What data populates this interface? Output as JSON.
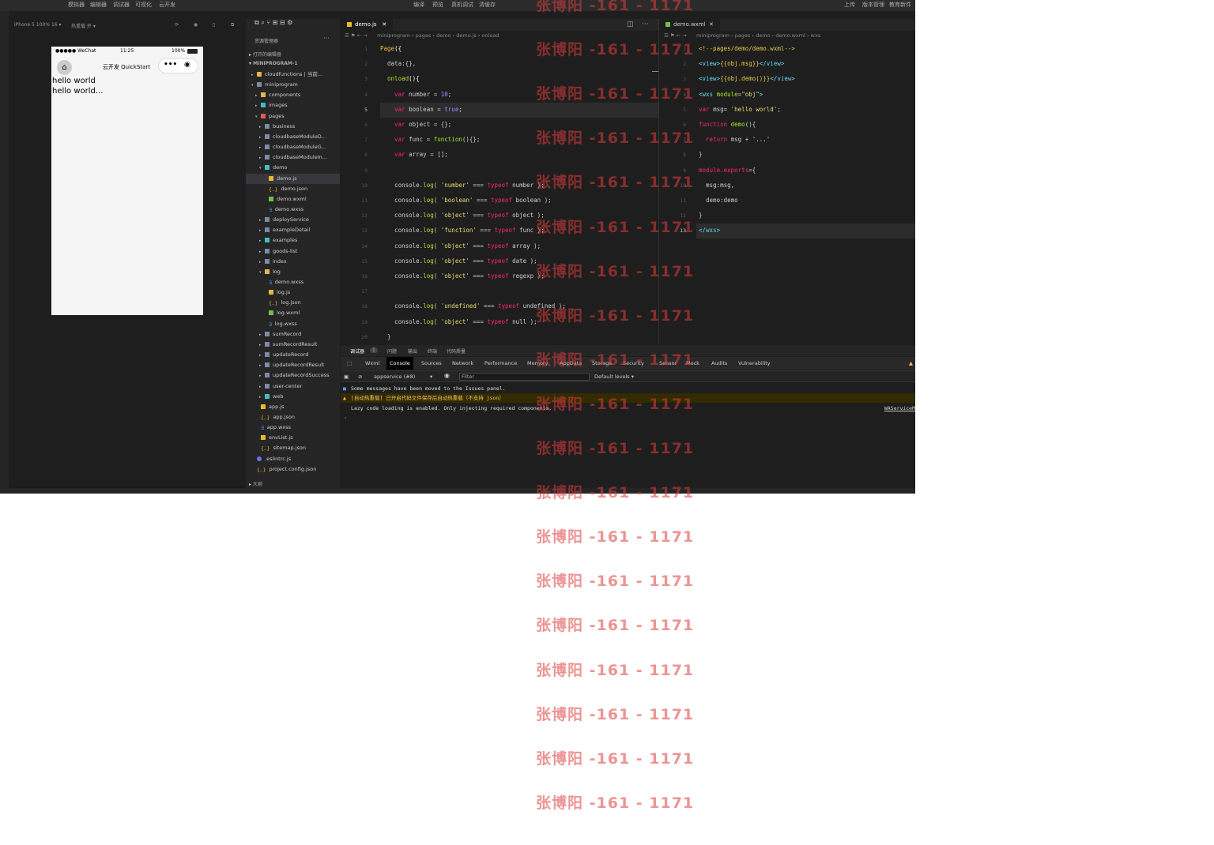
{
  "menubar": {
    "left": [
      "模拟器",
      "编辑器",
      "调试器",
      "可视化",
      "云开发"
    ],
    "center": [
      "编译",
      "预览",
      "真机调试",
      "清缓存"
    ],
    "right": [
      "上传",
      "版本管理",
      "教育新件"
    ]
  },
  "simulator": {
    "device": "iPhone 5 100% 16 ▾",
    "hotreload": "热重载 开 ▾",
    "status_carrier": "●●●●● WeChat",
    "status_time": "11:25",
    "status_battery": "100%",
    "nav_title": "云开发 QuickStart",
    "capsule_dots": "•••",
    "body_lines": [
      "hello world",
      "hello world..."
    ]
  },
  "explorer": {
    "title": "资源管理器",
    "open_editors": "打开的编辑器",
    "project": "MINIPROGRAM-1",
    "outline": "大纲",
    "items": [
      {
        "label": "cloudfunctions | 当前...",
        "type": "folderspec",
        "depth": 1,
        "arrow": "▸"
      },
      {
        "label": "miniprogram",
        "type": "folder",
        "depth": 1,
        "arrow": "▾"
      },
      {
        "label": "components",
        "type": "folderspec",
        "depth": 2,
        "arrow": "▸"
      },
      {
        "label": "images",
        "type": "folderteal",
        "depth": 2,
        "arrow": "▸"
      },
      {
        "label": "pages",
        "type": "folderred",
        "depth": 2,
        "arrow": "▾"
      },
      {
        "label": "business",
        "type": "folder",
        "depth": 3,
        "arrow": "▸"
      },
      {
        "label": "cloudbaseModuleD...",
        "type": "folder",
        "depth": 3,
        "arrow": "▸"
      },
      {
        "label": "cloudbaseModuleG...",
        "type": "folder",
        "depth": 3,
        "arrow": "▸"
      },
      {
        "label": "cloudbaseModuleIn...",
        "type": "folder",
        "depth": 3,
        "arrow": "▸"
      },
      {
        "label": "demo",
        "type": "folderteal",
        "depth": 3,
        "arrow": "▾"
      },
      {
        "label": "demo.js",
        "type": "js",
        "depth": 4,
        "arrow": "",
        "sel": true
      },
      {
        "label": "demo.json",
        "type": "json",
        "depth": 4,
        "arrow": ""
      },
      {
        "label": "demo.wxml",
        "type": "wxml",
        "depth": 4,
        "arrow": ""
      },
      {
        "label": "demo.wxss",
        "type": "wxss",
        "depth": 4,
        "arrow": ""
      },
      {
        "label": "deployService",
        "type": "folder",
        "depth": 3,
        "arrow": "▸"
      },
      {
        "label": "exampleDetail",
        "type": "folder",
        "depth": 3,
        "arrow": "▸"
      },
      {
        "label": "examples",
        "type": "folderteal",
        "depth": 3,
        "arrow": "▸"
      },
      {
        "label": "goods-list",
        "type": "folder",
        "depth": 3,
        "arrow": "▸"
      },
      {
        "label": "index",
        "type": "folder",
        "depth": 3,
        "arrow": "▸"
      },
      {
        "label": "log",
        "type": "folderspec",
        "depth": 3,
        "arrow": "▾"
      },
      {
        "label": "demo.wxss",
        "type": "wxss",
        "depth": 4,
        "arrow": ""
      },
      {
        "label": "log.js",
        "type": "js",
        "depth": 4,
        "arrow": ""
      },
      {
        "label": "log.json",
        "type": "json",
        "depth": 4,
        "arrow": ""
      },
      {
        "label": "log.wxml",
        "type": "wxml",
        "depth": 4,
        "arrow": ""
      },
      {
        "label": "log.wxss",
        "type": "wxss",
        "depth": 4,
        "arrow": ""
      },
      {
        "label": "sumRecord",
        "type": "folder",
        "depth": 3,
        "arrow": "▸"
      },
      {
        "label": "sumRecordResult",
        "type": "folder",
        "depth": 3,
        "arrow": "▸"
      },
      {
        "label": "updateRecord",
        "type": "folder",
        "depth": 3,
        "arrow": "▸"
      },
      {
        "label": "updateRecordResult",
        "type": "folder",
        "depth": 3,
        "arrow": "▸"
      },
      {
        "label": "updateRecordSuccess",
        "type": "folder",
        "depth": 3,
        "arrow": "▸"
      },
      {
        "label": "user-center",
        "type": "folder",
        "depth": 3,
        "arrow": "▸"
      },
      {
        "label": "web",
        "type": "folderteal",
        "depth": 3,
        "arrow": "▸"
      },
      {
        "label": "app.js",
        "type": "js",
        "depth": 2,
        "arrow": ""
      },
      {
        "label": "app.json",
        "type": "json",
        "depth": 2,
        "arrow": ""
      },
      {
        "label": "app.wxss",
        "type": "wxss",
        "depth": 2,
        "arrow": ""
      },
      {
        "label": "envList.js",
        "type": "js",
        "depth": 2,
        "arrow": ""
      },
      {
        "label": "sitemap.json",
        "type": "json",
        "depth": 2,
        "arrow": ""
      },
      {
        "label": ".eslintrc.js",
        "type": "eslint",
        "depth": 1,
        "arrow": ""
      },
      {
        "label": "project.config.json",
        "type": "json",
        "depth": 1,
        "arrow": ""
      }
    ]
  },
  "editor1": {
    "tab": "demo.js",
    "close": "✕",
    "breadcrumb": [
      "miniprogram",
      "pages",
      "demo",
      "demo.js",
      "onload"
    ],
    "lines": [
      [
        [
          "Page",
          "fn"
        ],
        [
          "({",
          "p"
        ]
      ],
      [
        [
          "  data",
          ""
        ],
        [
          ":{},",
          ""
        ]
      ],
      [
        [
          "  onload",
          "f"
        ],
        [
          "(){",
          "p"
        ]
      ],
      [
        [
          "    var ",
          "k"
        ],
        [
          "number = ",
          ""
        ],
        [
          "10",
          "n"
        ],
        [
          ";",
          ""
        ]
      ],
      [
        [
          "    var ",
          "k"
        ],
        [
          "boolean = ",
          ""
        ],
        [
          "true",
          "b"
        ],
        [
          ";",
          ""
        ]
      ],
      [
        [
          "    var ",
          "k"
        ],
        [
          "object = {};",
          ""
        ]
      ],
      [
        [
          "    var ",
          "k"
        ],
        [
          "func = ",
          ""
        ],
        [
          "function",
          "f"
        ],
        [
          "(){};",
          ""
        ]
      ],
      [
        [
          "    var ",
          "k"
        ],
        [
          "array = [];",
          ""
        ]
      ],
      [
        [
          "",
          ""
        ]
      ],
      [
        [
          "    console.",
          ""
        ],
        [
          "log",
          "f"
        ],
        [
          "( ",
          ""
        ],
        [
          "'number'",
          "s"
        ],
        [
          " === ",
          ""
        ],
        [
          "typeof",
          "k"
        ],
        [
          " number );",
          ""
        ]
      ],
      [
        [
          "    console.",
          ""
        ],
        [
          "log",
          "f"
        ],
        [
          "( ",
          ""
        ],
        [
          "'boolean'",
          "s"
        ],
        [
          " === ",
          ""
        ],
        [
          "typeof",
          "k"
        ],
        [
          " boolean );",
          ""
        ]
      ],
      [
        [
          "    console.",
          ""
        ],
        [
          "log",
          "f"
        ],
        [
          "( ",
          ""
        ],
        [
          "'object'",
          "s"
        ],
        [
          " === ",
          ""
        ],
        [
          "typeof",
          "k"
        ],
        [
          " object );",
          ""
        ]
      ],
      [
        [
          "    console.",
          ""
        ],
        [
          "log",
          "f"
        ],
        [
          "( ",
          ""
        ],
        [
          "'function'",
          "s"
        ],
        [
          " === ",
          ""
        ],
        [
          "typeof",
          "k"
        ],
        [
          " func );",
          ""
        ]
      ],
      [
        [
          "    console.",
          ""
        ],
        [
          "log",
          "f"
        ],
        [
          "( ",
          ""
        ],
        [
          "'object'",
          "s"
        ],
        [
          " === ",
          ""
        ],
        [
          "typeof",
          "k"
        ],
        [
          " array );",
          ""
        ]
      ],
      [
        [
          "    console.",
          ""
        ],
        [
          "log",
          "f"
        ],
        [
          "( ",
          ""
        ],
        [
          "'object'",
          "s"
        ],
        [
          " === ",
          ""
        ],
        [
          "typeof",
          "k"
        ],
        [
          " date );",
          ""
        ]
      ],
      [
        [
          "    console.",
          ""
        ],
        [
          "log",
          "f"
        ],
        [
          "( ",
          ""
        ],
        [
          "'object'",
          "s"
        ],
        [
          " === ",
          ""
        ],
        [
          "typeof",
          "k"
        ],
        [
          " regexp );",
          ""
        ]
      ],
      [
        [
          "",
          ""
        ]
      ],
      [
        [
          "    console.",
          ""
        ],
        [
          "log",
          "f"
        ],
        [
          "( ",
          ""
        ],
        [
          "'undefined'",
          "s"
        ],
        [
          " === ",
          ""
        ],
        [
          "typeof",
          "k"
        ],
        [
          " undefined );",
          ""
        ]
      ],
      [
        [
          "    console.",
          ""
        ],
        [
          "log",
          "f"
        ],
        [
          "( ",
          ""
        ],
        [
          "'object'",
          "s"
        ],
        [
          " === ",
          ""
        ],
        [
          "typeof",
          "k"
        ],
        [
          " null );",
          ""
        ]
      ],
      [
        [
          "  }",
          ""
        ]
      ]
    ]
  },
  "editor2": {
    "tab": "demo.wxml",
    "close": "✕",
    "breadcrumb": [
      "miniprogram",
      "pages",
      "demo",
      "demo.wxml",
      "wxs"
    ],
    "lines": [
      [
        [
          "<!--pages/demo/demo.wxml-->",
          "y"
        ]
      ],
      [
        [
          "<view>",
          "t"
        ],
        [
          "{{obj.msg}}",
          "y"
        ],
        [
          "</view>",
          "t"
        ]
      ],
      [
        [
          "<view>",
          "t"
        ],
        [
          "{{obj.demo()}}",
          "y"
        ],
        [
          "</view>",
          "t"
        ]
      ],
      [
        [
          "<wxs ",
          "t"
        ],
        [
          "module",
          "f"
        ],
        [
          "=",
          ""
        ],
        [
          "\"obj\"",
          "s"
        ],
        [
          ">",
          "t"
        ]
      ],
      [
        [
          "var ",
          "k"
        ],
        [
          "msg= ",
          ""
        ],
        [
          "'hello world'",
          "s"
        ],
        [
          ";",
          ""
        ]
      ],
      [
        [
          "function ",
          "k"
        ],
        [
          "demo",
          "f"
        ],
        [
          "(){",
          ""
        ]
      ],
      [
        [
          "  return ",
          "k"
        ],
        [
          "msg + ",
          ""
        ],
        [
          "'...'",
          "s"
        ]
      ],
      [
        [
          "}",
          ""
        ]
      ],
      [
        [
          "module.exports",
          "k"
        ],
        [
          "={",
          ""
        ]
      ],
      [
        [
          "  msg:msg,",
          ""
        ]
      ],
      [
        [
          "  demo:demo",
          ""
        ]
      ],
      [
        [
          "}",
          ""
        ]
      ],
      [
        [
          "</wxs>",
          "t"
        ]
      ]
    ]
  },
  "panel": {
    "tabs": [
      "调试器",
      "问题",
      "输出",
      "终端",
      "代码质量"
    ],
    "badge": "1"
  },
  "devtools": {
    "tabs": [
      "Wxml",
      "Console",
      "Sources",
      "Network",
      "Performance",
      "Memory",
      "AppData",
      "Storage",
      "Security",
      "Sensor",
      "Mock",
      "Audits",
      "Vulnerability"
    ],
    "active": "Console",
    "warn_icon": "▲"
  },
  "console": {
    "context": "appservice (#8)",
    "filter_placeholder": "Filter",
    "levels": "Default levels ▾",
    "messages": [
      {
        "text": "Some messages have been moved to the Issues panel.",
        "kind": "info"
      },
      {
        "text": "[自动热重载] 已开启代码文件保存后自动热重载（不支持 json）",
        "kind": "warn"
      },
      {
        "text": "Lazy code loading is enabled. Only injecting required components.",
        "kind": "log",
        "src": "WAServiceM"
      }
    ],
    "prompt": "›"
  },
  "watermark": "张博阳 -161 - 1171"
}
